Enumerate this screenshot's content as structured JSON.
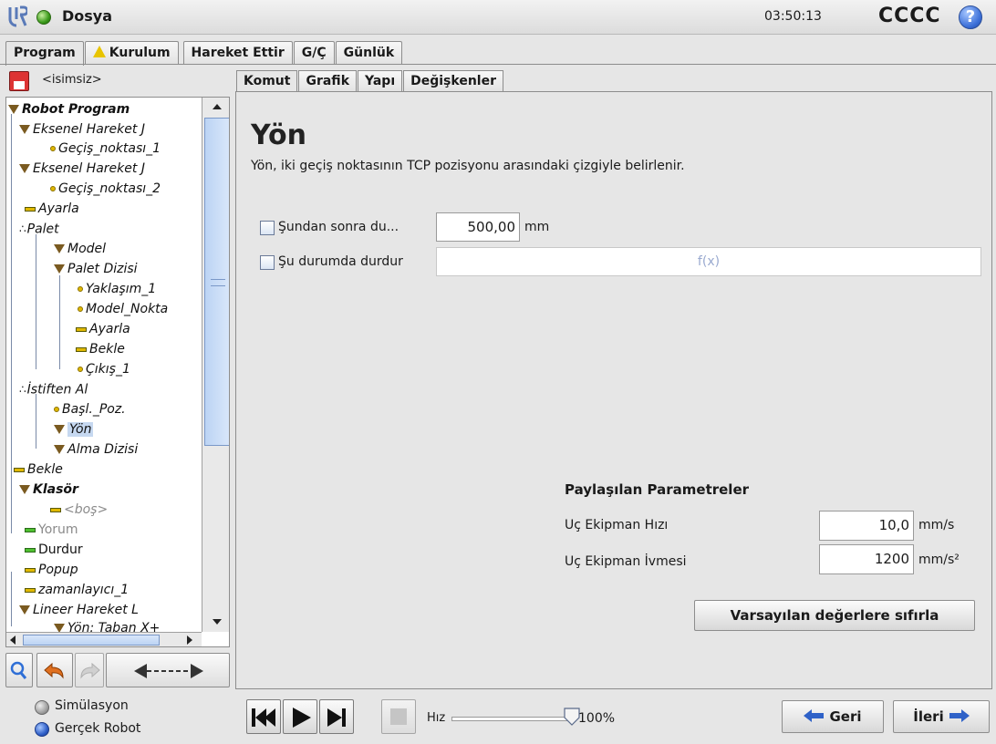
{
  "titlebar": {
    "app_title": "Dosya",
    "clock": "03:50:13",
    "robot_name": "CCCC",
    "help_label": "?"
  },
  "main_tabs": [
    "Program",
    "Kurulum",
    "Hareket Ettir",
    "G/Ç",
    "Günlük"
  ],
  "file": {
    "name": "<isimsiz>"
  },
  "sub_tabs": [
    "Komut",
    "Grafik",
    "Yapı",
    "Değişkenler"
  ],
  "tree": [
    {
      "label": "Robot Program",
      "icon": "folder-triangle-icon"
    },
    {
      "label": "Eksenel Hareket J",
      "icon": "move-triangle-icon"
    },
    {
      "label": "Geçiş_noktası_1",
      "icon": "waypoint-dot-icon"
    },
    {
      "label": "Eksenel Hareket J",
      "icon": "move-triangle-icon"
    },
    {
      "label": "Geçiş_noktası_2",
      "icon": "waypoint-dot-icon"
    },
    {
      "label": "Ayarla",
      "icon": "set-dash-icon"
    },
    {
      "label": "Palet",
      "icon": "pallet-icon"
    },
    {
      "label": "Model",
      "icon": "triangle-icon"
    },
    {
      "label": "Palet Dizisi",
      "icon": "triangle-icon"
    },
    {
      "label": "Yaklaşım_1",
      "icon": "waypoint-dot-icon"
    },
    {
      "label": "Model_Nokta",
      "icon": "waypoint-dot-icon"
    },
    {
      "label": "Ayarla",
      "icon": "set-dash-icon"
    },
    {
      "label": "Bekle",
      "icon": "wait-dash-icon"
    },
    {
      "label": "Çıkış_1",
      "icon": "waypoint-dot-icon"
    },
    {
      "label": "İstiften Al",
      "icon": "pallet-icon"
    },
    {
      "label": "Başl._Poz.",
      "icon": "waypoint-dot-icon"
    },
    {
      "label": "Yön",
      "icon": "triangle-icon"
    },
    {
      "label": "Alma Dizisi",
      "icon": "triangle-icon"
    },
    {
      "label": "Bekle",
      "icon": "wait-dash-icon"
    },
    {
      "label": "Klasör",
      "icon": "folder-triangle-icon"
    },
    {
      "label": "<boş>",
      "icon": "empty-dash-icon"
    },
    {
      "label": "Yorum",
      "icon": "comment-dash-icon"
    },
    {
      "label": "Durdur",
      "icon": "halt-dash-icon"
    },
    {
      "label": "Popup",
      "icon": "popup-dash-icon"
    },
    {
      "label": "zamanlayıcı_1",
      "icon": "timer-dash-icon"
    },
    {
      "label": "Lineer Hareket L",
      "icon": "move-triangle-icon"
    },
    {
      "label": "Yön: Taban X+",
      "icon": "triangle-icon"
    }
  ],
  "command": {
    "title": "Yön",
    "description": "Yön, iki geçiş noktasının TCP pozisyonu arasındaki çizgiyle belirlenir.",
    "stop_after_label": "Şundan sonra du...",
    "stop_after_value": "500,00",
    "stop_after_unit": "mm",
    "stop_when_label": "Şu durumda durdur",
    "stop_when_placeholder": "f(x)",
    "shared_params_title": "Paylaşılan Parametreler",
    "tool_speed_label": "Uç Ekipman Hızı",
    "tool_speed_value": "10,0",
    "tool_speed_unit": "mm/s",
    "tool_accel_label": "Uç Ekipman İvmesi",
    "tool_accel_value": "1200",
    "tool_accel_unit": "mm/s²",
    "reset_label": "Varsayılan değerlere sıfırla"
  },
  "bottom": {
    "simulation_label": "Simülasyon",
    "real_robot_label": "Gerçek Robot",
    "speed_label": "Hız",
    "speed_value": "100%",
    "speed_fraction": 1.0,
    "back_label": "Geri",
    "next_label": "İleri"
  }
}
